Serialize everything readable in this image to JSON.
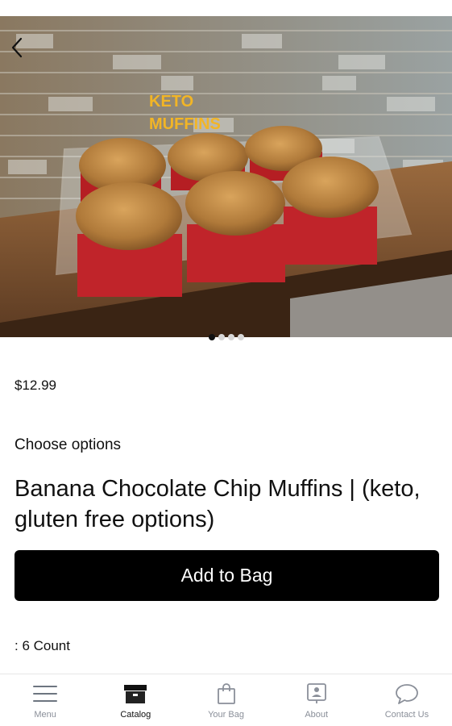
{
  "hero": {
    "image_label": "Keto muffins in a clear plastic container on a wooden counter",
    "overlay_text_line1": "KETO",
    "overlay_text_line2": "MUFFINS",
    "dots_count": 4,
    "active_dot": 1
  },
  "icons": {
    "back": "chevron-left-icon",
    "menu": "hamburger-icon",
    "catalog": "box-icon",
    "bag": "shopping-bag-icon",
    "about": "info-card-icon",
    "contact": "chat-bubble-icon"
  },
  "product": {
    "price": "$12.99",
    "choose_options": "Choose options",
    "title": "Banana Chocolate Chip Muffins | (keto, gluten free options)",
    "add_to_bag": "Add to Bag",
    "variant": ": 6 Count"
  },
  "nav": {
    "items": [
      {
        "label": "Menu"
      },
      {
        "label": "Catalog"
      },
      {
        "label": "Your Bag"
      },
      {
        "label": "About"
      },
      {
        "label": "Contact Us"
      }
    ],
    "active": "Catalog"
  },
  "colors": {
    "button_bg": "#000000",
    "button_text": "#ffffff",
    "nav_inactive": "#8a8f99",
    "accent_text": "#f2b526"
  }
}
